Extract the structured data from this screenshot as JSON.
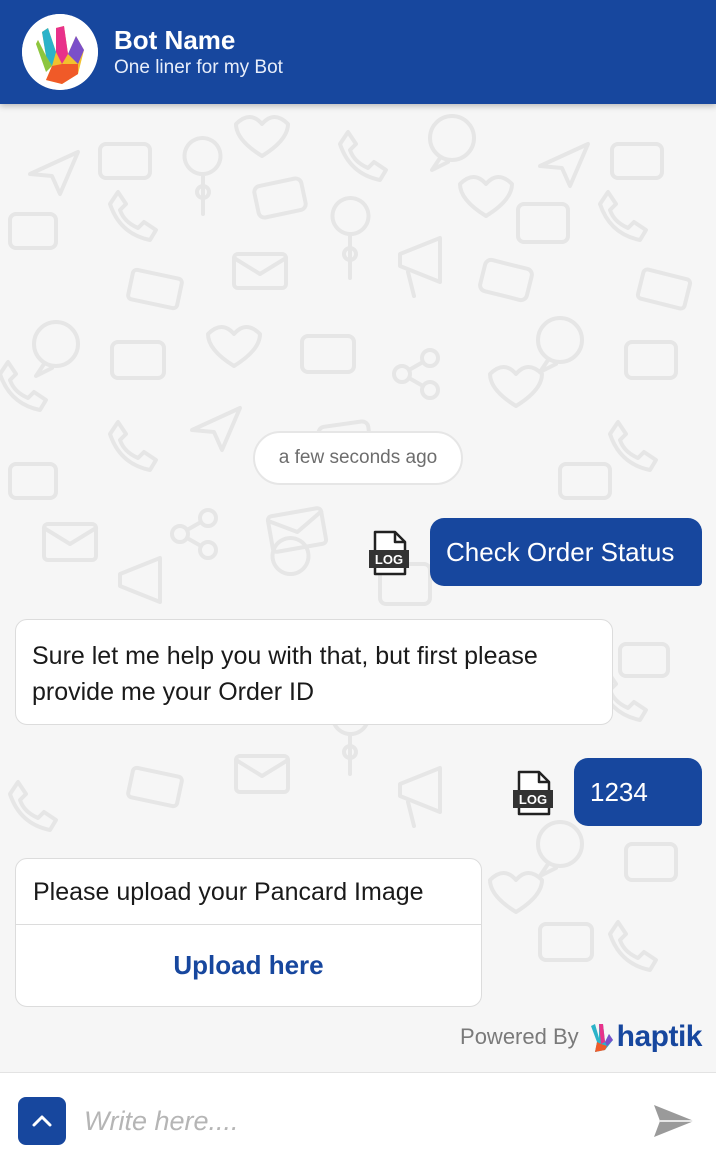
{
  "header": {
    "bot_name": "Bot Name",
    "subtitle": "One liner for my Bot",
    "background_color": "#17479e"
  },
  "timestamp": "a few seconds ago",
  "messages": [
    {
      "sender": "user",
      "text": "Check Order Status",
      "icon": "log-file-icon",
      "icon_label": "LOG"
    },
    {
      "sender": "bot",
      "text": "Sure let me help you with that, but first please provide me your Order ID"
    },
    {
      "sender": "user",
      "text": "1234",
      "icon": "log-file-icon",
      "icon_label": "LOG"
    },
    {
      "sender": "bot",
      "type": "card",
      "text": "Please upload your Pancard Image",
      "button_label": "Upload here"
    }
  ],
  "powered_by": {
    "label": "Powered By",
    "brand": "haptik"
  },
  "composer": {
    "placeholder": "Write here....",
    "menu_icon": "chevron-up-icon",
    "send_icon": "send-icon"
  },
  "colors": {
    "accent": "#17479e",
    "chat_background": "#f6f6f6"
  }
}
